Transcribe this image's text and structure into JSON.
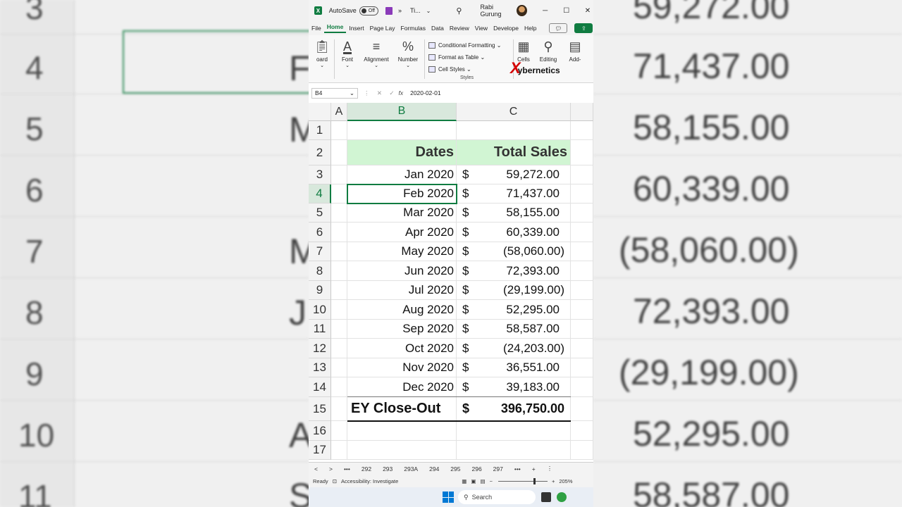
{
  "background_zoom": {
    "rows": [
      {
        "num": "3",
        "val": "59,272.00"
      },
      {
        "num": "4",
        "val": "71,437.00"
      },
      {
        "num": "5",
        "val": "58,155.00"
      },
      {
        "num": "6",
        "val": "60,339.00"
      },
      {
        "num": "7",
        "val": "(58,060.00)"
      },
      {
        "num": "8",
        "val": "72,393.00"
      },
      {
        "num": "9",
        "val": "(29,199.00)"
      },
      {
        "num": "10",
        "val": "52,295.00"
      },
      {
        "num": "11",
        "val": "58,587.00"
      }
    ],
    "partial_letters": [
      "F",
      "M",
      "M",
      "J",
      "A",
      "S"
    ]
  },
  "titlebar": {
    "autosave_label": "AutoSave",
    "autosave_state": "Off",
    "more": "»",
    "file_name": "Ti...",
    "user_name": "Rabi Gurung",
    "minimize": "─",
    "maximize": "☐",
    "close": "✕"
  },
  "menu": [
    "File",
    "Home",
    "Insert",
    "Page Lay",
    "Formulas",
    "Data",
    "Review",
    "View",
    "Develope",
    "Help"
  ],
  "ribbon": {
    "clipboard": "oard",
    "font": "Font",
    "alignment": "Alignment",
    "number": "Number",
    "conditional_formatting": "Conditional Formatting",
    "format_as_table": "Format as Table",
    "cell_styles": "Cell Styles",
    "styles_group": "Styles",
    "cells": "Cells",
    "editing": "Editing",
    "addins": "Add-",
    "addins_group": "Add",
    "logo_text": "ybernetics"
  },
  "formula_bar": {
    "name_box": "B4",
    "fx": "fx",
    "value": "2020-02-01"
  },
  "grid": {
    "columns": [
      "A",
      "B",
      "C"
    ],
    "row_numbers": [
      "1",
      "2",
      "3",
      "4",
      "5",
      "6",
      "7",
      "8",
      "9",
      "10",
      "11",
      "12",
      "13",
      "14",
      "15",
      "16",
      "17"
    ],
    "header_dates": "Dates",
    "header_sales": "Total Sales",
    "currency": "$",
    "rows": [
      {
        "date": "Jan 2020",
        "amount": "59,272.00",
        "neg": false
      },
      {
        "date": "Feb 2020",
        "amount": "71,437.00",
        "neg": false
      },
      {
        "date": "Mar 2020",
        "amount": "58,155.00",
        "neg": false
      },
      {
        "date": "Apr 2020",
        "amount": "60,339.00",
        "neg": false
      },
      {
        "date": "May 2020",
        "amount": "(58,060.00)",
        "neg": true
      },
      {
        "date": "Jun 2020",
        "amount": "72,393.00",
        "neg": false
      },
      {
        "date": "Jul 2020",
        "amount": "(29,199.00)",
        "neg": true
      },
      {
        "date": "Aug 2020",
        "amount": "52,295.00",
        "neg": false
      },
      {
        "date": "Sep 2020",
        "amount": "58,587.00",
        "neg": false
      },
      {
        "date": "Oct 2020",
        "amount": "(24,203.00)",
        "neg": true
      },
      {
        "date": "Nov 2020",
        "amount": "36,551.00",
        "neg": false
      },
      {
        "date": "Dec 2020",
        "amount": "39,183.00",
        "neg": false
      }
    ],
    "total_label": "EY Close-Out",
    "total_amount": "396,750.00",
    "selected_cell": "B4"
  },
  "sheet_tabs": {
    "prev": "<",
    "next": ">",
    "ellipsis": "•••",
    "tabs": [
      "292",
      "293",
      "293A",
      "294",
      "295",
      "296",
      "297"
    ],
    "more": "•••",
    "add": "+",
    "menu": "⋮"
  },
  "status_bar": {
    "ready": "Ready",
    "accessibility": "Accessibility: Investigate",
    "zoom_out": "−",
    "zoom_in": "+",
    "zoom": "205%"
  },
  "taskbar": {
    "search": "Search"
  },
  "colors": {
    "excel_green": "#107c41",
    "header_fill": "#d1f5d3",
    "selection_fill": "#d8e8dc"
  }
}
